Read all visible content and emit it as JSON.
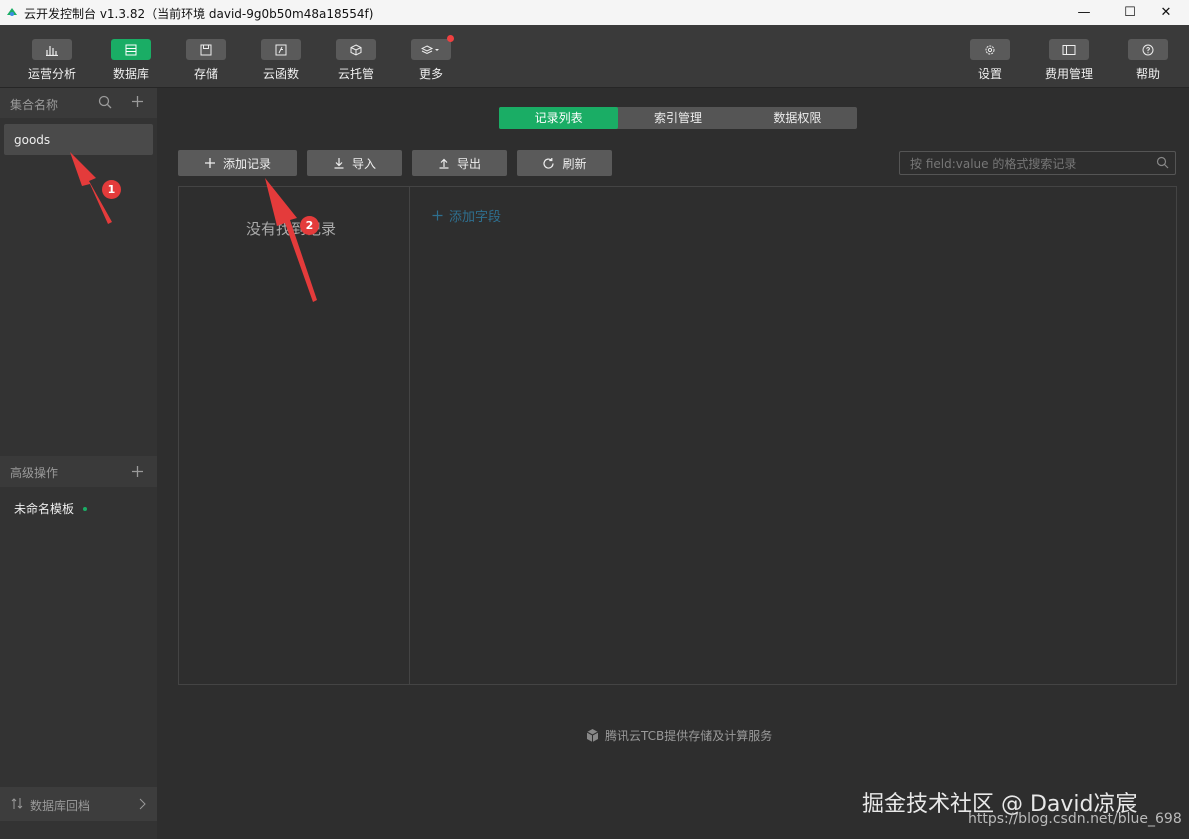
{
  "window": {
    "title": "云开发控制台 v1.3.82（当前环境 david-9g0b50m48a18554f)",
    "minimize_glyph": "—",
    "maximize_glyph": "☐",
    "close_glyph": "✕"
  },
  "toolbar": {
    "left_items": [
      {
        "label": "运营分析",
        "icon": "bar-chart-icon"
      },
      {
        "label": "数据库",
        "icon": "database-icon",
        "active": true
      },
      {
        "label": "存储",
        "icon": "save-icon"
      },
      {
        "label": "云函数",
        "icon": "function-icon"
      },
      {
        "label": "云托管",
        "icon": "cube-icon"
      },
      {
        "label": "更多",
        "icon": "layers-icon",
        "has_notification": true
      }
    ],
    "right_items": [
      {
        "label": "设置",
        "icon": "gear-icon"
      },
      {
        "label": "费用管理",
        "icon": "billing-icon"
      },
      {
        "label": "帮助",
        "icon": "help-icon"
      }
    ]
  },
  "sidebar": {
    "collections_header": "集合名称",
    "collections": [
      "goods"
    ],
    "advanced_header": "高级操作",
    "templates": [
      "未命名模板"
    ],
    "footer_label": "数据库回档"
  },
  "main": {
    "tabs": [
      {
        "label": "记录列表",
        "active": true
      },
      {
        "label": "索引管理",
        "active": false
      },
      {
        "label": "数据权限",
        "active": false
      }
    ],
    "actions": {
      "add_record": "添加记录",
      "import": "导入",
      "export": "导出",
      "refresh": "刷新"
    },
    "search_placeholder": "按 field:value 的格式搜索记录",
    "empty_message": "没有找到记录",
    "add_field": "添加字段",
    "footer_note": "腾讯云TCB提供存储及计算服务"
  },
  "annotations": {
    "badge_1": "1",
    "badge_2": "2",
    "watermark": "掘金技术社区 @ David凉宸",
    "watermark_url": "https://blog.csdn.net/blue_698"
  },
  "colors": {
    "accent": "#1aad65",
    "annotation_red": "#e43b3b",
    "link_blue": "#2e6f8f",
    "background": "#2e2e2e"
  }
}
